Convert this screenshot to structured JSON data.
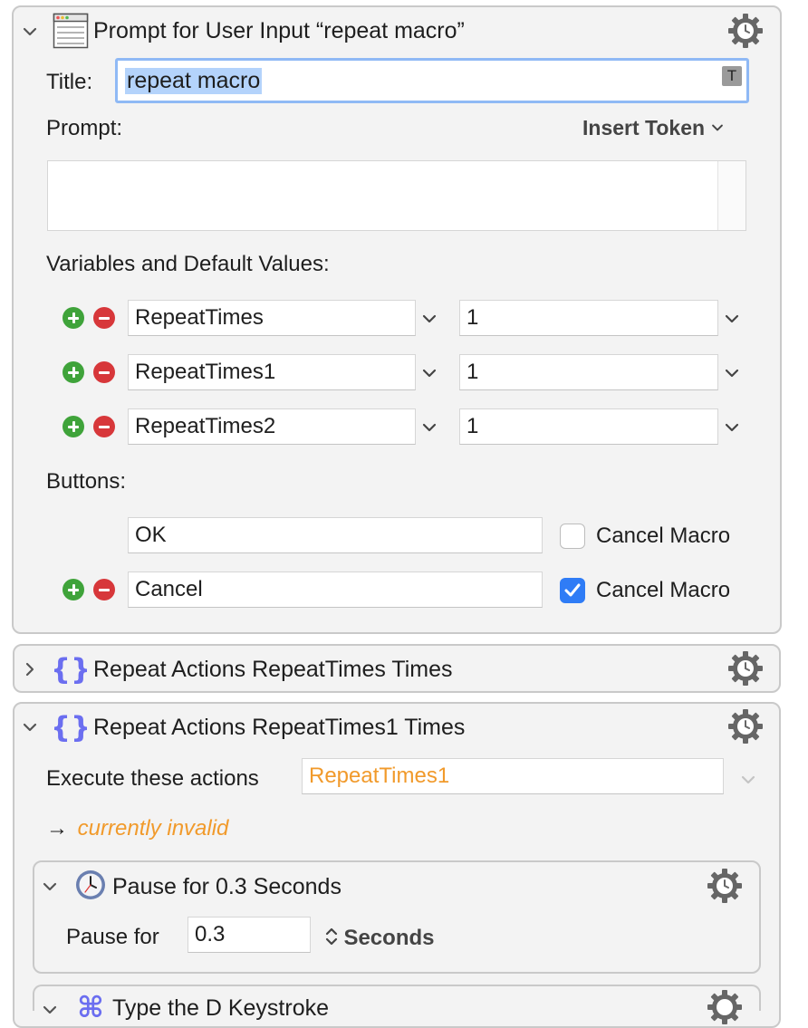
{
  "prompt_action": {
    "title_text": "Prompt for User Input “repeat macro”",
    "title_label": "Title:",
    "title_value": "repeat macro",
    "title_token_glyph": "T",
    "prompt_label": "Prompt:",
    "insert_token_label": "Insert Token",
    "prompt_value": "",
    "variables_label": "Variables and Default Values:",
    "variables": [
      {
        "name": "RepeatTimes",
        "default": "1"
      },
      {
        "name": "RepeatTimes1",
        "default": "1"
      },
      {
        "name": "RepeatTimes2",
        "default": "1"
      }
    ],
    "buttons_label": "Buttons:",
    "buttons": [
      {
        "name": "OK",
        "cancel_label": "Cancel Macro",
        "cancel_checked": false
      },
      {
        "name": "Cancel",
        "cancel_label": "Cancel Macro",
        "cancel_checked": true
      }
    ]
  },
  "repeat_action_1": {
    "title_text": "Repeat Actions RepeatTimes Times"
  },
  "repeat_action_2": {
    "title_text": "Repeat Actions RepeatTimes1 Times",
    "execute_label": "Execute these actions",
    "execute_value": "RepeatTimes1",
    "status_arrow": "→",
    "status_text": "currently invalid"
  },
  "pause_action": {
    "title_text": "Pause for 0.3 Seconds",
    "pause_label": "Pause for",
    "pause_value": "0.3",
    "unit_label": "Seconds"
  },
  "type_action": {
    "title_text": "Type the D Keystroke"
  },
  "colors": {
    "accent": "#2f7cf6",
    "warning_orange": "#f19a2b",
    "plus_green": "#3fa33a",
    "minus_red": "#d7373a",
    "selection": "#b4d3fb"
  }
}
